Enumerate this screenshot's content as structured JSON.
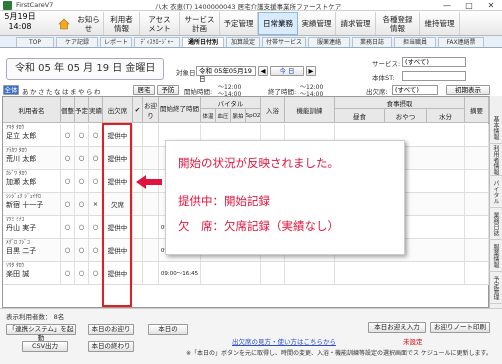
{
  "titlebar": {
    "app": "FirstCareV7",
    "center": "八木 衣恵(T) 1400000043 居宅介護支援事業所ファーストケア",
    "minimize": "—",
    "maximize": "□",
    "close": "✕"
  },
  "topnav": {
    "date": "5月19日",
    "time": "14:08",
    "items": [
      "お知らせ",
      "利用者\n情報",
      "アセス\nメント",
      "サービス\n計画",
      "予定管理",
      "日常業務",
      "実績管理",
      "請求管理",
      "各種登録\n情報",
      "維持管理"
    ],
    "active_index": 5
  },
  "subtabs": {
    "items": [
      "TOP",
      "ケア記録",
      "レポート",
      "ﾃﾞｨｽｸﾛｰｼﾞｬｰ",
      "通所日付別",
      "加算設定",
      "付帯サービス",
      "服薬連絡",
      "業務日誌",
      "担当職員",
      "FAX連絡票"
    ],
    "active_index": 4
  },
  "filter": {
    "date_display": "令和 05 年 05 月 19 日 金曜日",
    "target_label": "対象日",
    "target_value": "令和 05年05月19日",
    "today_btn": "今 日",
    "service_label": "サービス:",
    "service_value": "(すべて)",
    "sub_label": "本体ST:",
    "prev_btn": "◀",
    "next_btn": "▶"
  },
  "filter2": {
    "kana_label": "全体",
    "kana_row": "あかさたなはまやらわ",
    "btn_home": "居宅",
    "btn_plan": "予防",
    "start_label": "開始時間:",
    "start_from": "～12:00",
    "start_to": "～14:00",
    "end_label": "終了時間:",
    "end_from": "～12:00",
    "end_to": "～14:00",
    "exit_label": "出欠席:",
    "exit_value": "(すべて)",
    "init_btn": "初期表示"
  },
  "table": {
    "headers": [
      "利用者名",
      "個整",
      "予定",
      "実績",
      "出欠席",
      "✔",
      "お迎り",
      "開始終了時間",
      "バイタル",
      "入浴",
      "機能訓練",
      "食事摂取",
      "摘要"
    ],
    "vital_sub": [
      "体温",
      "血圧",
      "脈拍",
      "SpO2"
    ],
    "meal_sub": [
      "昼食",
      "おやつ",
      "水分"
    ],
    "rows": [
      {
        "kana": "ｱｷﾀ ﾀﾛｳ",
        "name": "足立 太郎",
        "ind": "○",
        "plan": "○",
        "act": "○",
        "status": "提供中",
        "time": ""
      },
      {
        "kana": "ｱﾗｶﾜ ﾀﾛｳ",
        "name": "荒川 太郎",
        "ind": "○",
        "plan": "○",
        "act": "○",
        "status": "提供中",
        "time": ""
      },
      {
        "kana": "ｶｼﾞﾜ ﾀﾛｳ",
        "name": "加瀬 太郎",
        "ind": "○",
        "plan": "○",
        "act": "○",
        "status": "提供中",
        "time": ""
      },
      {
        "kana": "ｼﾝｼﾞｭｸ ｼﾞｭｲﾁﾛ",
        "name": "新宿 十一子",
        "ind": "○",
        "plan": "○",
        "act": "×",
        "status": "欠席",
        "time": ""
      },
      {
        "kana": "ﾏﾂﾐ ﾐﾅｺ",
        "name": "丹山 実子",
        "ind": "○",
        "plan": "○",
        "act": "○",
        "status": "提供中",
        "time": "09:00～16:00"
      },
      {
        "kana": "ﾒｸﾞﾛ ﾌｼﾞｺ",
        "name": "目黒 二子",
        "ind": "○",
        "plan": "○",
        "act": "○",
        "status": "提供中",
        "time": "09:00～16:45"
      },
      {
        "kana": "ｿｳﾀ ﾀﾛｳ",
        "name": "楽田 誠",
        "ind": "○",
        "plan": "○",
        "act": "○",
        "status": "提供中",
        "time": "09:00～16:45"
      }
    ],
    "row_extra": {
      "training": "加算Ⅰイ\n・プ火(1)"
    }
  },
  "callout": {
    "line1": "開始の状況が反映されました。",
    "line2": "提供中：開始記録",
    "line3": "欠　席：欠席記録（実績なし）"
  },
  "sidebar": {
    "tabs": [
      "基本情報",
      "利用者情報",
      "バイタル",
      "業務日誌",
      "服薬情報",
      "予定管理"
    ]
  },
  "footer": {
    "count_label": "表示利用者数： 8名",
    "btn_renkei": "「連携システム」を起動",
    "btn_start": "本日のお迎り",
    "btn_date": "本日の",
    "btn_csv": "CSV出力",
    "btn_end": "本日の終わり",
    "link": "出欠席の見方・使い方はこちらから",
    "btn_pickup": "本日お迎え入力",
    "btn_pickup2": "お迎りノート印刷",
    "unsent_label": "未設定",
    "note": "※「本日の」ボタンを元に取得し、時間の変更、入浴・機能訓練等設定の選択画面でス ケジュールに更新します。"
  },
  "colors": {
    "accent": "#e0143c",
    "box": "#e02020",
    "link": "#2a4cd6",
    "nav_active": "#d9ecff"
  }
}
